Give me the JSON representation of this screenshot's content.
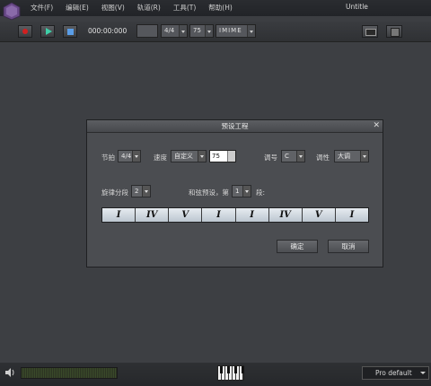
{
  "menu": [
    "文件(F)",
    "编辑(E)",
    "视图(V)",
    "轨道(R)",
    "工具(T)",
    "帮助(H)"
  ],
  "window_title": "Untitle",
  "toolbar": {
    "time": "000:00:000",
    "meter": "4/4",
    "tempo": "75",
    "mode": "IMIME"
  },
  "dialog": {
    "title": "预设工程",
    "beat_label": "节拍",
    "beat_value": "4/4",
    "speed_label": "速度",
    "speed_mode": "自定义",
    "speed_value": "75",
    "key_label": "调号",
    "key_value": "C",
    "mode_label": "调性",
    "mode_value": "大调",
    "segment_label": "旋律分段",
    "segment_value": "2",
    "chord_label": "和弦预设，第",
    "chord_index": "1",
    "chord_suffix": "段:",
    "chords": [
      "I",
      "IV",
      "V",
      "I",
      "I",
      "IV",
      "V",
      "I"
    ],
    "ok_label": "确定",
    "cancel_label": "取消"
  },
  "bottom": {
    "preset": "Pro default"
  }
}
